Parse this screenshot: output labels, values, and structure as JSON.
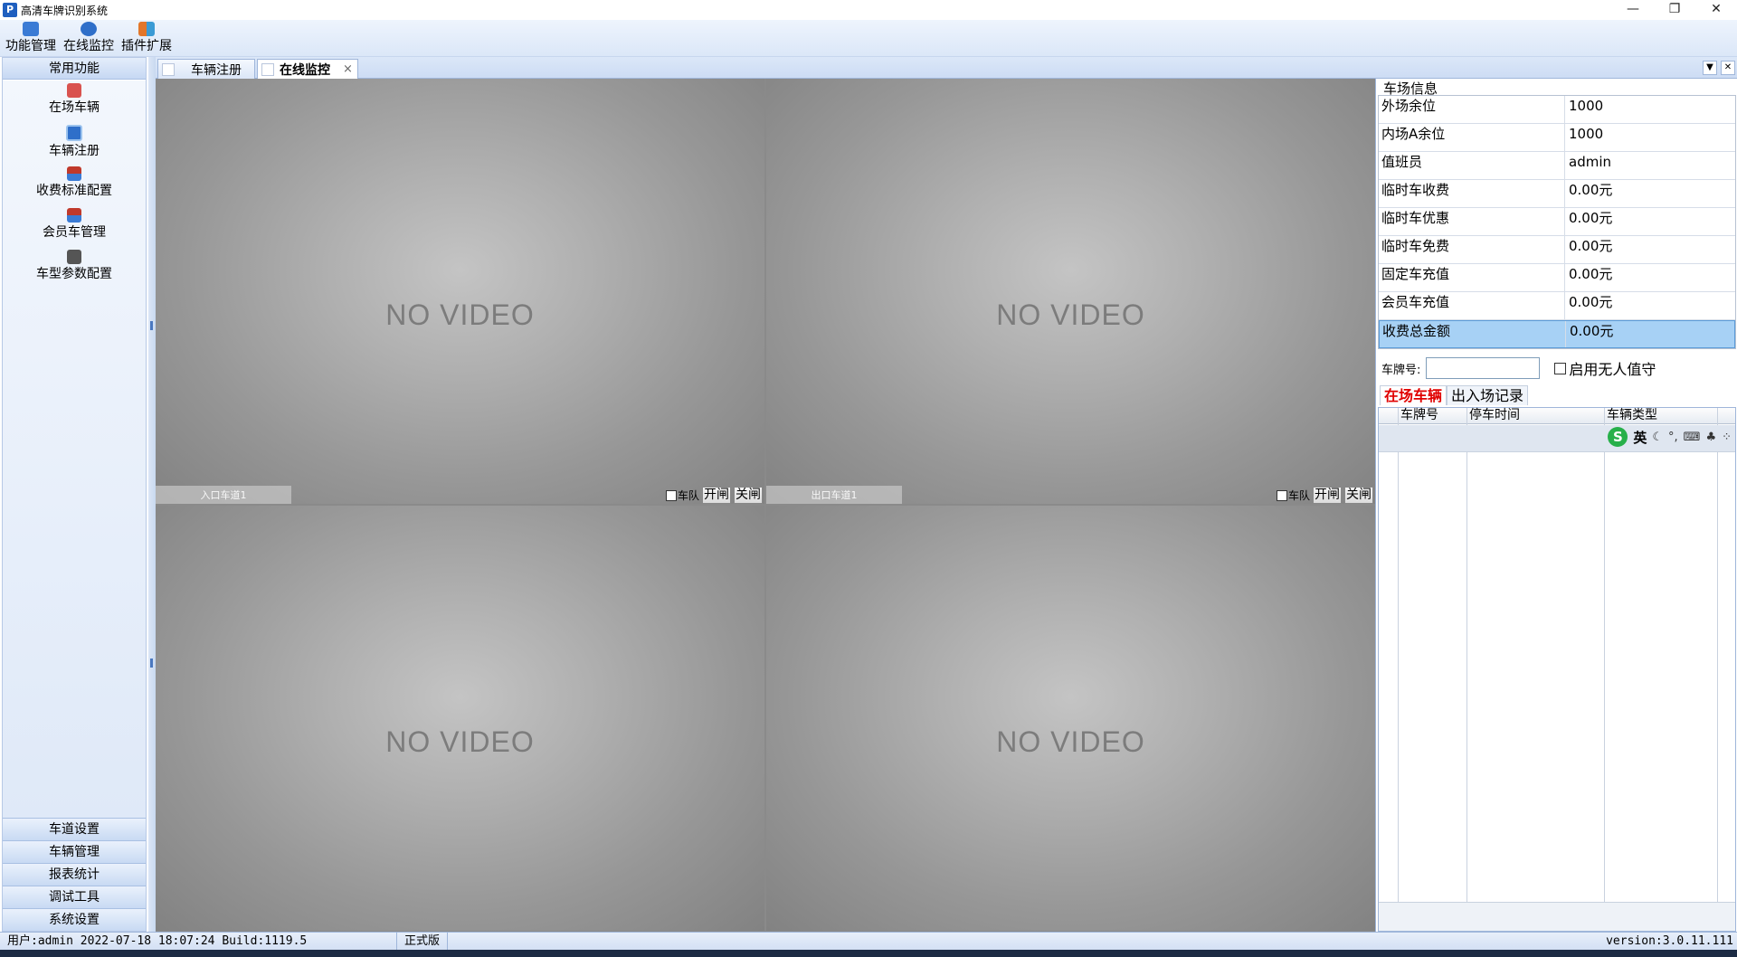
{
  "window": {
    "title": "高清车牌识别系统",
    "app_icon": "P",
    "minimize": "—",
    "maximize": "❐",
    "close": "✕"
  },
  "menu": [
    {
      "label": "功能管理",
      "icon": "function-manage-icon",
      "color": "#3a7bd5"
    },
    {
      "label": "在线监控",
      "icon": "online-monitor-icon",
      "color": "#2f6fc9"
    },
    {
      "label": "插件扩展",
      "icon": "plugin-extend-icon",
      "color": "#e2762a"
    }
  ],
  "sidebar": {
    "header": "常用功能",
    "items": [
      {
        "label": "在场车辆",
        "icon": "car-red-icon",
        "color": "#d9534f"
      },
      {
        "label": "车辆注册",
        "icon": "car-register-icon",
        "color": "#2f6fc9"
      },
      {
        "label": "收费标准配置",
        "icon": "fee-config-icon",
        "color": "#c0392b"
      },
      {
        "label": "会员车管理",
        "icon": "member-car-icon",
        "color": "#c0392b"
      },
      {
        "label": "车型参数配置",
        "icon": "vehicle-type-icon",
        "color": "#555555"
      }
    ],
    "footer": [
      "车道设置",
      "车辆管理",
      "报表统计",
      "调试工具",
      "系统设置"
    ]
  },
  "tabs": [
    {
      "label": "车辆注册",
      "active": false
    },
    {
      "label": "在线监控",
      "active": true,
      "close": "×"
    }
  ],
  "tab_controls": {
    "dropdown": "▼",
    "close": "✕"
  },
  "cameras": [
    {
      "no_video": "NO VIDEO",
      "lane": "入口车道1",
      "fleet": "车队",
      "open": "开闸",
      "close": "关闸"
    },
    {
      "no_video": "NO VIDEO",
      "lane": "出口车道1",
      "fleet": "车队",
      "open": "开闸",
      "close": "关闸"
    },
    {
      "no_video": "NO VIDEO"
    },
    {
      "no_video": "NO VIDEO"
    }
  ],
  "lot_info": {
    "title": "车场信息",
    "rows": [
      {
        "key": "外场余位",
        "value": "1000"
      },
      {
        "key": "内场A余位",
        "value": "1000"
      },
      {
        "key": "值班员",
        "value": "admin"
      },
      {
        "key": "临时车收费",
        "value": "0.00元"
      },
      {
        "key": "临时车优惠",
        "value": "0.00元"
      },
      {
        "key": "临时车免费",
        "value": "0.00元"
      },
      {
        "key": "固定车充值",
        "value": "0.00元"
      },
      {
        "key": "会员车充值",
        "value": "0.00元"
      },
      {
        "key": "收费总金额",
        "value": "0.00元",
        "selected": true
      }
    ]
  },
  "plate_search": {
    "label": "车牌号:",
    "value": "",
    "unattended_label": "启用无人值守",
    "unattended_checked": false
  },
  "sub_tabs": [
    {
      "label": "在场车辆",
      "active": true
    },
    {
      "label": "出入场记录",
      "active": false
    }
  ],
  "grid": {
    "columns": [
      "车牌号",
      "停车时间",
      "车辆类型"
    ],
    "ime": {
      "logo": "S",
      "mode": "英",
      "icons": [
        "☾",
        "°,",
        "⌨",
        "♣",
        "⁘"
      ]
    }
  },
  "status": {
    "user": "用户:admin 2022-07-18 18:07:24 Build:1119.5",
    "edition": "正式版",
    "version": "version:3.0.11.111"
  }
}
